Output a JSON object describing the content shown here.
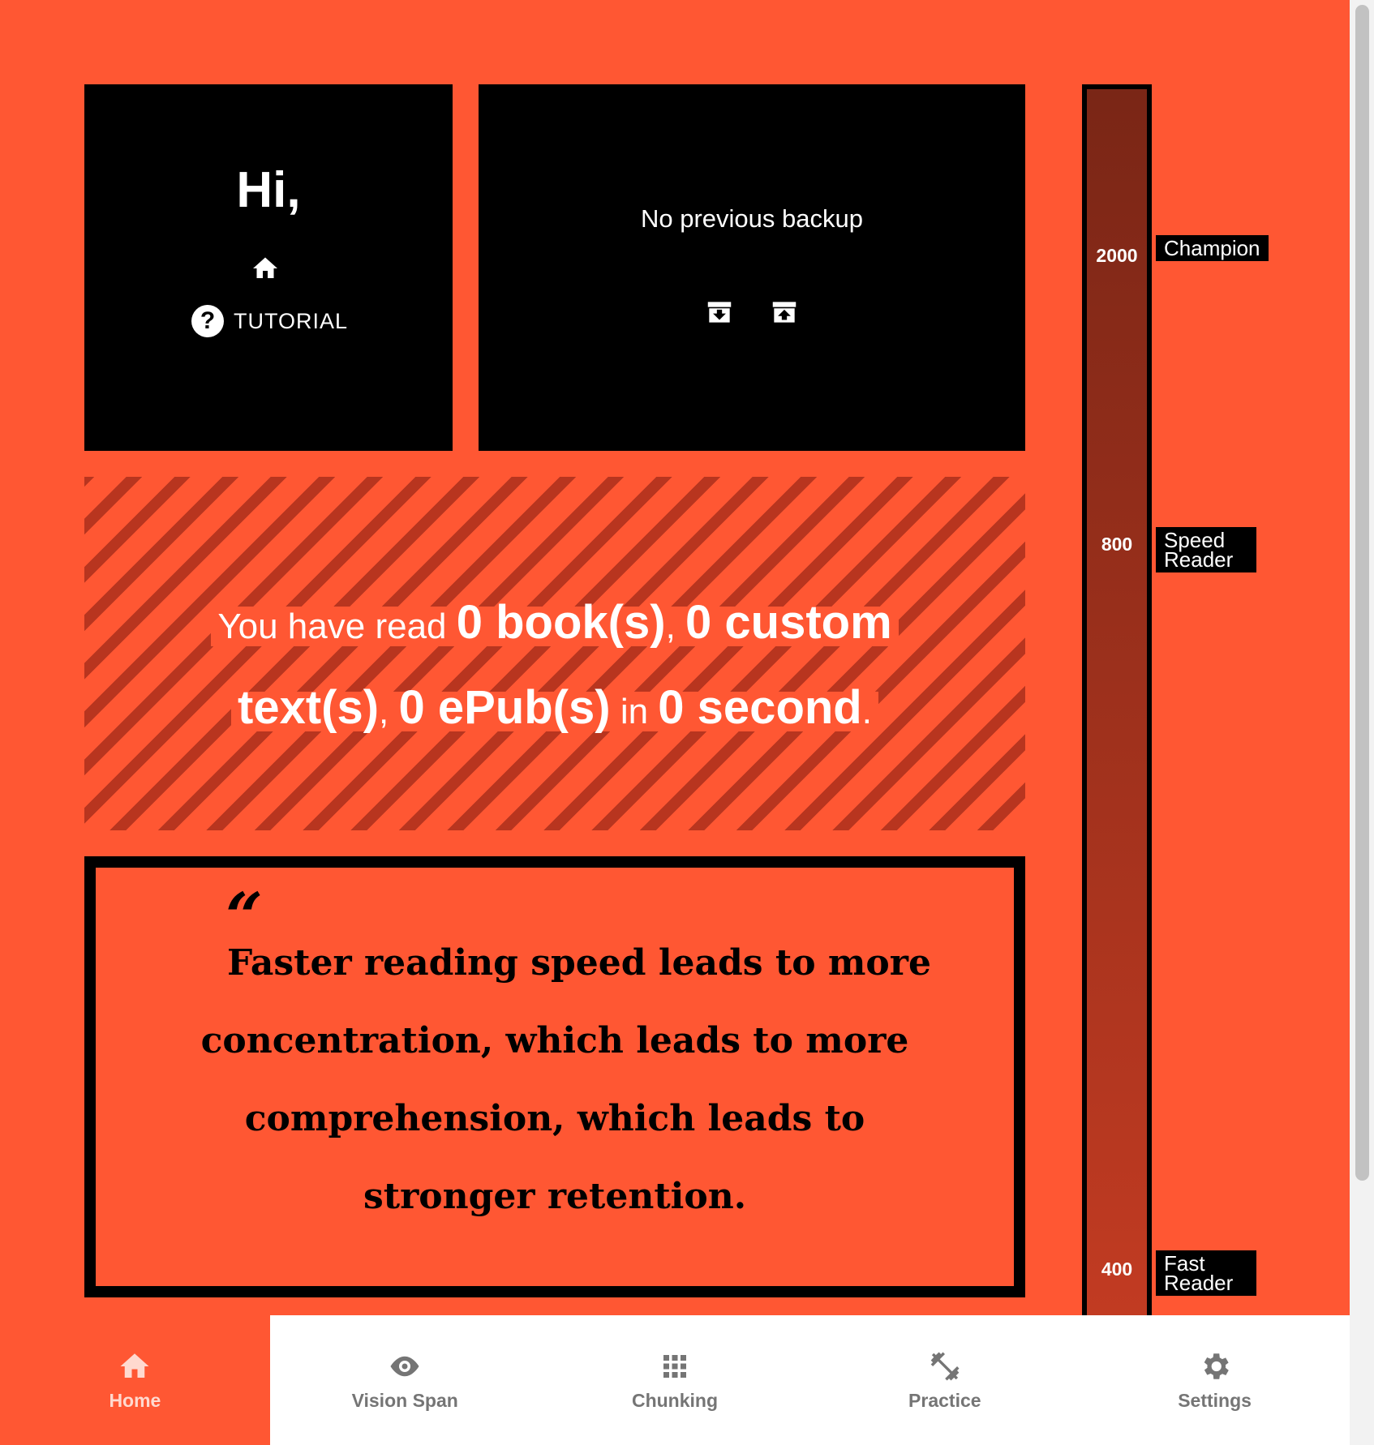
{
  "greeting": {
    "title": "Hi,",
    "tutorial_label": "TUTORIAL"
  },
  "backup": {
    "status": "No previous backup"
  },
  "stats": {
    "intro": "You have read",
    "books": "0 book(s)",
    "custom": "0 custom text(s)",
    "epubs": "0 ePub(s)",
    "in_word": "in",
    "time": "0 second",
    "sep1": ",",
    "sep2": ",",
    "end": "."
  },
  "quote": {
    "mark": "“",
    "text": "Faster reading speed leads to more concentration, which leads to more comprehension, which leads to stronger retention."
  },
  "meter": {
    "levels": [
      {
        "value": "2000",
        "label": "Champion"
      },
      {
        "value": "800",
        "label": "Speed Reader"
      },
      {
        "value": "400",
        "label": "Fast Reader"
      }
    ]
  },
  "nav": {
    "items": [
      {
        "label": "Home",
        "icon": "home-icon"
      },
      {
        "label": "Vision Span",
        "icon": "eye-icon"
      },
      {
        "label": "Chunking",
        "icon": "grid-icon"
      },
      {
        "label": "Practice",
        "icon": "dumbbell-icon"
      },
      {
        "label": "Settings",
        "icon": "gear-icon"
      }
    ]
  },
  "colors": {
    "accent": "#ff5733",
    "dark": "#000000",
    "meter_top": "#7a2616",
    "meter_bottom": "#c23b22"
  }
}
